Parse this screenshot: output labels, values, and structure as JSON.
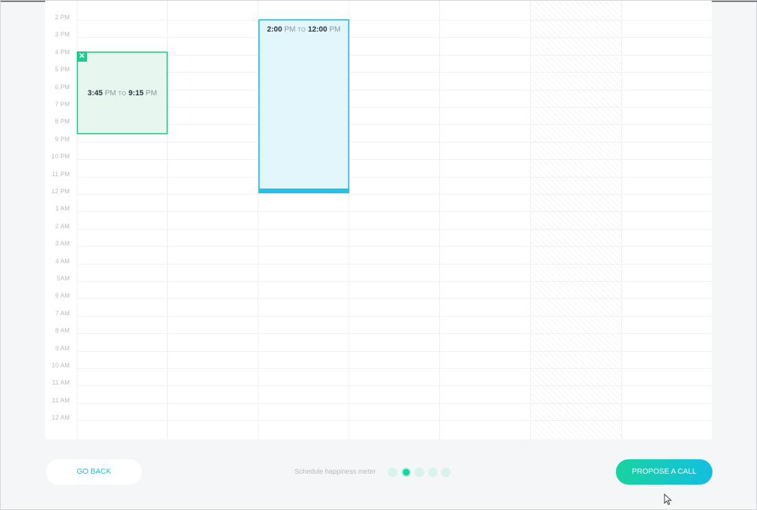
{
  "calendar": {
    "hours": [
      "2 PM",
      "3 PM",
      "4 PM",
      "5 PM",
      "6 PM",
      "7 PM",
      "8 PM",
      "9 PM",
      "10 PM",
      "11 PM",
      "12 PM",
      "1 AM",
      "2 AM",
      "3 AM",
      "4 AM",
      "5AM",
      "6 AM",
      "7 AM",
      "8 AM",
      "9 AM",
      "10 AM",
      "11 AM",
      "11 AM",
      "12 AM"
    ],
    "events": {
      "green": {
        "start": "3:45",
        "start_suffix": "PM",
        "to": "TO",
        "end": "9:15",
        "end_suffix": "PM",
        "close_symbol": "✕"
      },
      "blue": {
        "start": "2:00",
        "start_suffix": "PM",
        "to": "TO",
        "end": "12:00",
        "end_suffix": "PM"
      }
    }
  },
  "footer": {
    "back_label": "GO BACK",
    "meter_label": "Schedule happiness meter",
    "meter_level": 2,
    "meter_total": 5,
    "propose_label": "PROPOSE  A CALL"
  },
  "colors": {
    "accent_green": "#1fca90",
    "accent_blue": "#24c3e6"
  }
}
